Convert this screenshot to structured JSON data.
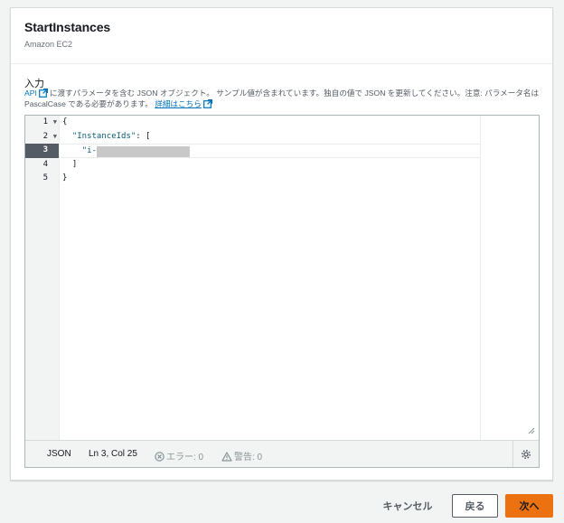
{
  "panel": {
    "title": "StartInstances",
    "subtitle": "Amazon EC2"
  },
  "input": {
    "label": "入力",
    "api_link": "API",
    "desc_part1": "に渡すパラメータを含む JSON オブジェクト。 サンプル値が含まれています。独自の値で JSON を更新してください。注意: パラメータ名は PascalCase である必要があります。",
    "details_link": "詳細はこちら"
  },
  "editor": {
    "line_numbers": [
      "1",
      "2",
      "3",
      "4",
      "5"
    ],
    "lines": {
      "l1": "{",
      "l2_key": "\"InstanceIds\"",
      "l2_rest": ": [",
      "l3_open": "\"i-",
      "l3_close": "\"",
      "l4": "  ]",
      "l5": "}"
    },
    "active_line": 3
  },
  "statusbar": {
    "language": "JSON",
    "cursor": "Ln 3, Col 25",
    "errors": "エラー: 0",
    "warnings": "警告: 0"
  },
  "footer": {
    "cancel": "キャンセル",
    "back": "戻る",
    "next": "次へ"
  },
  "colors": {
    "primary": "#ec7211",
    "link": "#0073bb",
    "active_gutter": "#545b64"
  }
}
